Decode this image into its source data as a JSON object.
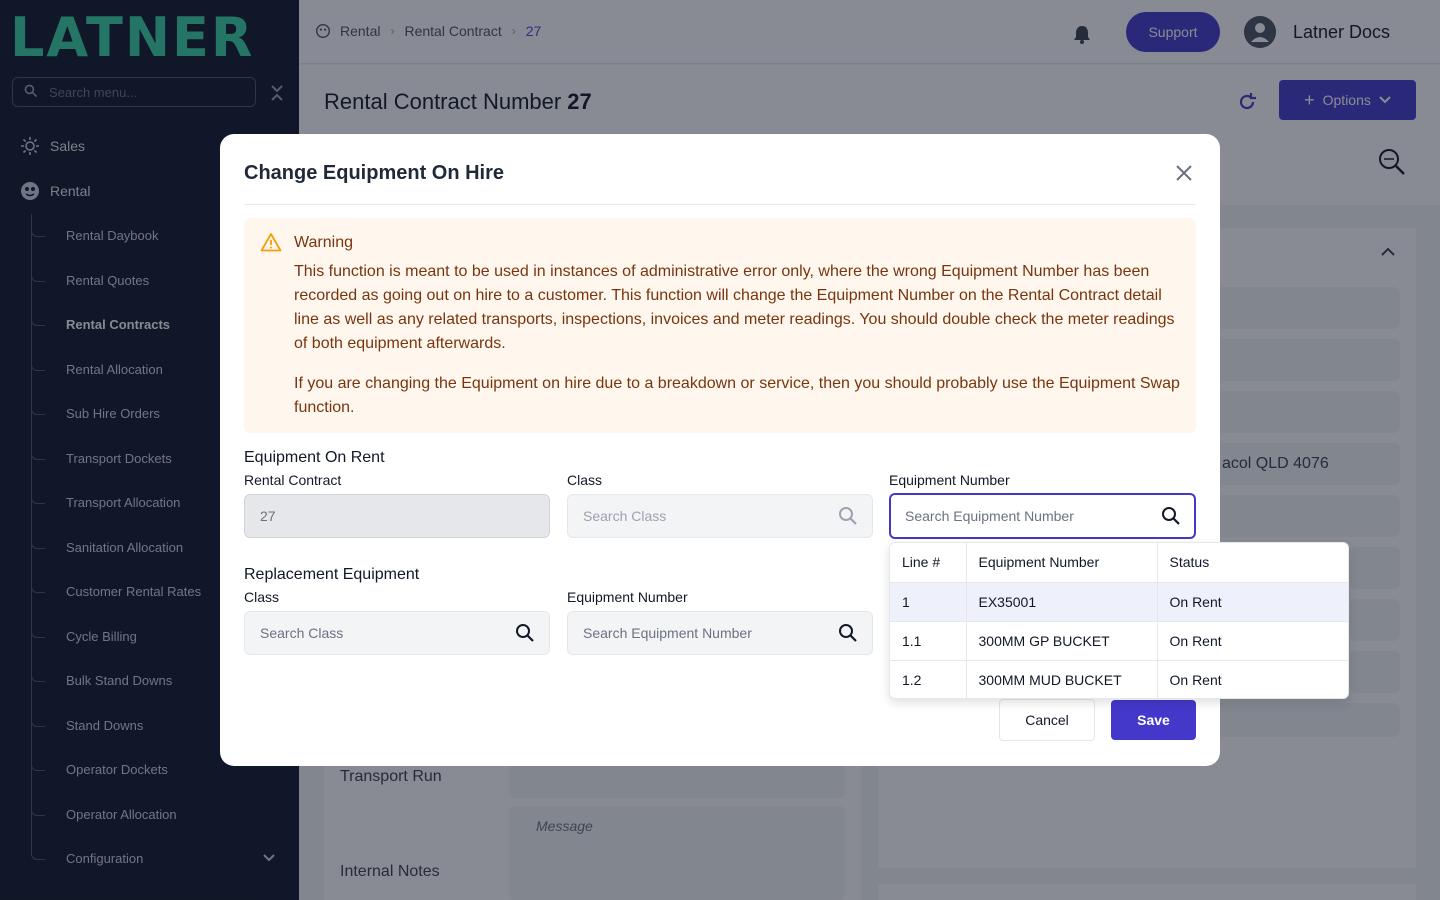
{
  "app": {
    "logo_text": "LATNER"
  },
  "sidebar": {
    "search_placeholder": "Search menu...",
    "top_items": [
      {
        "label": "Sales",
        "icon": "sales-icon"
      },
      {
        "label": "Rental",
        "icon": "rental-icon"
      }
    ],
    "items": [
      {
        "label": "Rental Daybook"
      },
      {
        "label": "Rental Quotes"
      },
      {
        "label": "Rental Contracts",
        "active": true
      },
      {
        "label": "Rental Allocation"
      },
      {
        "label": "Sub Hire Orders"
      },
      {
        "label": "Transport Dockets"
      },
      {
        "label": "Transport Allocation"
      },
      {
        "label": "Sanitation Allocation"
      },
      {
        "label": "Customer Rental Rates"
      },
      {
        "label": "Cycle Billing"
      },
      {
        "label": "Bulk Stand Downs"
      },
      {
        "label": "Stand Downs"
      },
      {
        "label": "Operator Dockets"
      },
      {
        "label": "Operator Allocation"
      },
      {
        "label": "Configuration"
      }
    ]
  },
  "breadcrumb": [
    "Rental",
    "Rental Contract",
    "27"
  ],
  "header": {
    "support_label": "Support",
    "user_name": "Latner Docs"
  },
  "page": {
    "title": "Rental Contract Number",
    "number": "27",
    "options_label": "Options"
  },
  "background": {
    "address_fragment": "acol QLD 4076",
    "transport_run_label": "Transport Run",
    "internal_notes_label": "Internal Notes",
    "message_placeholder": "Message"
  },
  "modal": {
    "title": "Change Equipment On Hire",
    "warning": {
      "title": "Warning",
      "paragraph1": "This function is meant to be used in instances of administrative error only, where the wrong Equipment Number has been recorded as going out on hire to a customer. This function will change the Equipment Number on the Rental Contract detail line as well as any related transports, inspections, invoices and meter readings. You should double check the meter readings of both equipment afterwards.",
      "paragraph2": "If you are changing the Equipment on hire due to a breakdown or service, then you should probably use the Equipment Swap function."
    },
    "on_rent": {
      "section_title": "Equipment On Rent",
      "rental_contract_label": "Rental Contract",
      "rental_contract_value": "27",
      "class_label": "Class",
      "class_placeholder": "Search Class",
      "equipment_label": "Equipment Number",
      "equipment_placeholder": "Search Equipment Number"
    },
    "replacement": {
      "section_title": "Replacement Equipment",
      "class_label": "Class",
      "class_placeholder": "Search Class",
      "equipment_label": "Equipment Number",
      "equipment_placeholder": "Search Equipment Number"
    },
    "cancel_label": "Cancel",
    "save_label": "Save"
  },
  "dropdown": {
    "columns": [
      "Line #",
      "Equipment Number",
      "Status"
    ],
    "rows": [
      {
        "line": "1",
        "equipment": "EX35001",
        "status": "On Rent",
        "selected": true
      },
      {
        "line": "1.1",
        "equipment": "300MM GP BUCKET",
        "status": "On Rent"
      },
      {
        "line": "1.2",
        "equipment": "300MM MUD BUCKET",
        "status": "On Rent"
      }
    ]
  },
  "colors": {
    "brand": "#38d3a6",
    "primary": "#4338ca",
    "sidebar_bg": "#0f172a",
    "warning_bg": "#fff7ed",
    "warning_text": "#78350f"
  }
}
